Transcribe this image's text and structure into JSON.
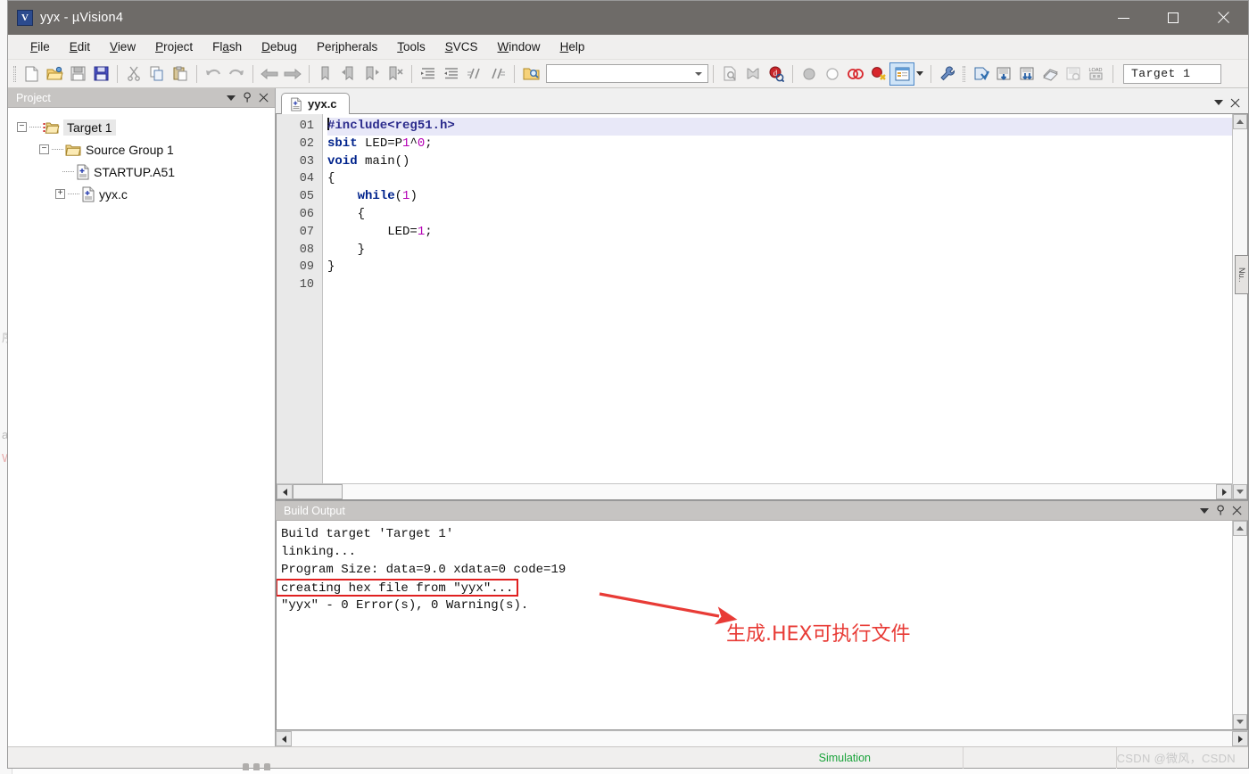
{
  "window": {
    "title": "yyx  - µVision4",
    "icon_name": "uvision-logo-icon",
    "minimize_label": "Minimize",
    "maximize_label": "Maximize",
    "close_label": "Close"
  },
  "menubar": {
    "items": [
      {
        "label": "File",
        "accel": "F"
      },
      {
        "label": "Edit",
        "accel": "E"
      },
      {
        "label": "View",
        "accel": "V"
      },
      {
        "label": "Project",
        "accel": "P"
      },
      {
        "label": "Flash",
        "accel": "a"
      },
      {
        "label": "Debug",
        "accel": "D"
      },
      {
        "label": "Peripherals",
        "accel": "i"
      },
      {
        "label": "Tools",
        "accel": "T"
      },
      {
        "label": "SVCS",
        "accel": "S"
      },
      {
        "label": "Window",
        "accel": "W"
      },
      {
        "label": "Help",
        "accel": "H"
      }
    ]
  },
  "toolbar": {
    "icons": [
      "new-file-icon",
      "open-file-icon",
      "save-icon",
      "save-all-icon",
      "cut-icon",
      "copy-icon",
      "paste-icon",
      "undo-icon",
      "redo-icon",
      "navigate-back-icon",
      "navigate-forward-icon",
      "bookmark-toggle-icon",
      "bookmark-prev-icon",
      "bookmark-next-icon",
      "bookmark-clear-icon",
      "indent-icon",
      "outdent-icon",
      "comment-icon",
      "uncomment-icon",
      "find-in-files-icon"
    ],
    "find_combo_placeholder": "",
    "find_combo_value": "",
    "icons_right": [
      "find-icon",
      "bookmark-search-icon",
      "debug-session-icon",
      "insert-breakpoint-icon",
      "kill-breakpoint-icon",
      "enable-breakpoint-icon",
      "disable-all-breakpoints-icon",
      "project-window-icon",
      "configure-icon"
    ],
    "icons_build": [
      "translate-icon",
      "build-target-icon",
      "rebuild-all-icon",
      "batch-build-icon",
      "stop-build-icon",
      "download-icon"
    ],
    "target_value": "Target 1"
  },
  "project_panel": {
    "caption": "Project",
    "caption_buttons": [
      "panel-menu-icon",
      "pin-icon",
      "close-icon"
    ],
    "tree": [
      {
        "label": "Target 1",
        "icon": "target-folder-icon",
        "expander": "-",
        "level": 1,
        "selected": true
      },
      {
        "label": "Source Group 1",
        "icon": "folder-icon",
        "expander": "-",
        "level": 2,
        "selected": false
      },
      {
        "label": "STARTUP.A51",
        "icon": "source-file-icon",
        "expander": "",
        "level": 3,
        "selected": false
      },
      {
        "label": "yyx.c",
        "icon": "source-file-icon",
        "expander": "+",
        "level": 3,
        "selected": false
      }
    ]
  },
  "editor": {
    "tab_label": "yyx.c",
    "tab_icon": "source-file-icon",
    "caption_buttons": [
      "panel-menu-icon",
      "close-icon"
    ],
    "line_numbers": [
      "01",
      "02",
      "03",
      "04",
      "05",
      "06",
      "07",
      "08",
      "09",
      "10"
    ],
    "lines": [
      {
        "n": 1,
        "current": true,
        "tokens": [
          {
            "t": "#include",
            "c": "pre"
          },
          {
            "t": "<reg51.h>",
            "c": "pre"
          }
        ]
      },
      {
        "n": 2,
        "current": false,
        "tokens": [
          {
            "t": "sbit",
            "c": "kw"
          },
          {
            "t": " LED=P",
            "c": "pln"
          },
          {
            "t": "1",
            "c": "num"
          },
          {
            "t": "^",
            "c": "pln"
          },
          {
            "t": "0",
            "c": "num"
          },
          {
            "t": ";",
            "c": "pln"
          }
        ]
      },
      {
        "n": 3,
        "current": false,
        "tokens": [
          {
            "t": "void",
            "c": "kw"
          },
          {
            "t": " main()",
            "c": "pln"
          }
        ]
      },
      {
        "n": 4,
        "current": false,
        "tokens": [
          {
            "t": "{",
            "c": "pln"
          }
        ]
      },
      {
        "n": 5,
        "current": false,
        "tokens": [
          {
            "t": "    ",
            "c": "pln"
          },
          {
            "t": "while",
            "c": "kw"
          },
          {
            "t": "(",
            "c": "pln"
          },
          {
            "t": "1",
            "c": "num"
          },
          {
            "t": ")",
            "c": "pln"
          }
        ]
      },
      {
        "n": 6,
        "current": false,
        "tokens": [
          {
            "t": "    {",
            "c": "pln"
          }
        ]
      },
      {
        "n": 7,
        "current": false,
        "tokens": [
          {
            "t": "        LED=",
            "c": "pln"
          },
          {
            "t": "1",
            "c": "num"
          },
          {
            "t": ";",
            "c": "pln"
          }
        ]
      },
      {
        "n": 8,
        "current": false,
        "tokens": [
          {
            "t": "    }",
            "c": "pln"
          }
        ]
      },
      {
        "n": 9,
        "current": false,
        "tokens": [
          {
            "t": "}",
            "c": "pln"
          }
        ]
      },
      {
        "n": 10,
        "current": false,
        "tokens": []
      }
    ],
    "code_text": [
      "#include<reg51.h>",
      "sbit LED=P1^0;",
      "void main()",
      "{",
      "    while(1)",
      "    {",
      "        LED=1;",
      "    }",
      "}",
      ""
    ]
  },
  "build_output": {
    "caption": "Build Output",
    "caption_buttons": [
      "panel-menu-icon",
      "pin-icon",
      "close-icon"
    ],
    "lines": [
      {
        "text": "Build target 'Target 1'",
        "boxed": false
      },
      {
        "text": "linking...",
        "boxed": false
      },
      {
        "text": "Program Size: data=9.0 xdata=0 code=19",
        "boxed": false
      },
      {
        "text": "creating hex file from \"yyx\"...",
        "boxed": true
      },
      {
        "text": "\"yyx\" - 0 Error(s), 0 Warning(s).",
        "boxed": false
      }
    ]
  },
  "annotation": {
    "text": "生成.HEX可执行文件",
    "color": "#e83b36",
    "arrow_name": "red-annotation-arrow"
  },
  "statusbar": {
    "left_text": "",
    "simulation_label": "Simulation",
    "middle_text": "",
    "watermark": "CSDN @微风，CSDN"
  },
  "right_dock": {
    "label": "Nu.."
  },
  "colors": {
    "titlebar_bg": "#6e6b68",
    "accent_red": "#e02020",
    "annotation_red": "#e83b36",
    "status_green": "#19a33a",
    "keyword_blue": "#00238c",
    "number_magenta": "#b500b5",
    "current_line": "#e8e8f8",
    "panel_caption": "#c6c4c2"
  }
}
